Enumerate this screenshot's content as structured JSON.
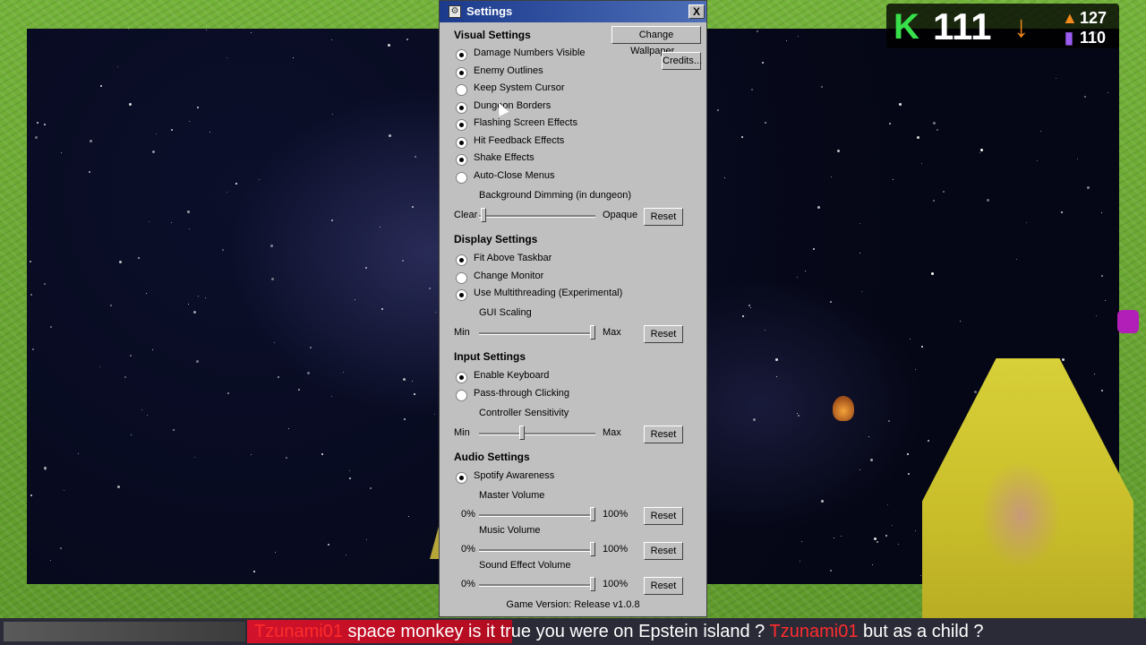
{
  "window": {
    "title": "Settings",
    "close_glyph": "X"
  },
  "buttons": {
    "change_wallpaper": "Change Wallpaper...",
    "credits": "Credits..."
  },
  "visual_settings": {
    "heading": "Visual Settings",
    "options": [
      {
        "label": "Damage Numbers Visible",
        "checked": true
      },
      {
        "label": "Enemy Outlines",
        "checked": true
      },
      {
        "label": "Keep System Cursor",
        "checked": false
      },
      {
        "label": "Dungeon Borders",
        "checked": true
      },
      {
        "label": "Flashing Screen Effects",
        "checked": true
      },
      {
        "label": "Hit Feedback Effects",
        "checked": true
      },
      {
        "label": "Shake Effects",
        "checked": true
      },
      {
        "label": "Auto-Close Menus",
        "checked": false
      }
    ],
    "dimming": {
      "title": "Background Dimming (in dungeon)",
      "min_label": "Clear",
      "max_label": "Opaque",
      "reset": "Reset",
      "level": 0.02
    }
  },
  "display_settings": {
    "heading": "Display Settings",
    "options": [
      {
        "label": "Fit Above Taskbar",
        "checked": true
      },
      {
        "label": "Change Monitor",
        "checked": false
      },
      {
        "label": "Use Multithreading (Experimental)",
        "checked": true
      }
    ],
    "gui_scaling": {
      "title": "GUI Scaling",
      "min_label": "Min",
      "max_label": "Max",
      "reset": "Reset",
      "level": 1.0
    }
  },
  "input_settings": {
    "heading": "Input Settings",
    "options": [
      {
        "label": "Enable Keyboard",
        "checked": true
      },
      {
        "label": "Pass-through Clicking",
        "checked": false
      }
    ],
    "controller_sensitivity": {
      "title": "Controller Sensitivity",
      "min_label": "Min",
      "max_label": "Max",
      "reset": "Reset",
      "level": 0.36
    }
  },
  "audio_settings": {
    "heading": "Audio Settings",
    "options": [
      {
        "label": "Spotify Awareness",
        "checked": true
      }
    ],
    "sliders": [
      {
        "title": "Master Volume",
        "min_label": "0%",
        "max_label": "100%",
        "reset": "Reset",
        "level": 1.0
      },
      {
        "title": "Music Volume",
        "min_label": "0%",
        "max_label": "100%",
        "reset": "Reset",
        "level": 1.0
      },
      {
        "title": "Sound Effect Volume",
        "min_label": "0%",
        "max_label": "100%",
        "reset": "Reset",
        "level": 1.0
      }
    ]
  },
  "version": "Game Version: Release v1.0.8",
  "hud": {
    "letter": "K",
    "count": "111",
    "arrow": "↓",
    "stat_top": "127",
    "stat_bottom": "110"
  },
  "ticker": {
    "user": "Tzunami01",
    "message": "space monkey is it true you were on Epstein island ?",
    "user2": "Tzunami01",
    "message2": "but as a child ?"
  },
  "colors": {
    "titlebar": "#1b3a8c",
    "dialog_bg": "#c0c0c0",
    "hud_green": "#38e04a",
    "hud_orange": "#f28a1c",
    "ticker_red": "#d1122a"
  }
}
